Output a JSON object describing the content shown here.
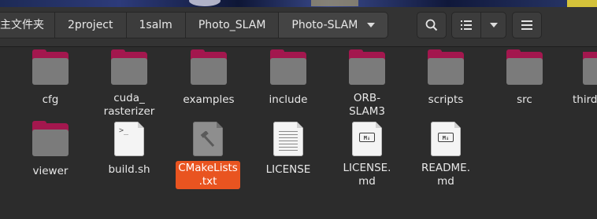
{
  "breadcrumbs": [
    {
      "label": "主文件夹"
    },
    {
      "label": "2project"
    },
    {
      "label": "1salm"
    },
    {
      "label": "Photo_SLAM"
    },
    {
      "label": "Photo-SLAM"
    }
  ],
  "toolbar": {
    "search_icon": "search-icon",
    "list_icon": "list-view-icon",
    "dropdown_icon": "chevron-down-icon",
    "menu_icon": "hamburger-menu-icon"
  },
  "files": [
    {
      "name": "cfg",
      "type": "folder"
    },
    {
      "name": "cuda_\nrasterizer",
      "type": "folder"
    },
    {
      "name": "examples",
      "type": "folder"
    },
    {
      "name": "include",
      "type": "folder"
    },
    {
      "name": "ORB-\nSLAM3",
      "type": "folder"
    },
    {
      "name": "scripts",
      "type": "folder"
    },
    {
      "name": "src",
      "type": "folder"
    },
    {
      "name": "third",
      "type": "folder"
    },
    {
      "name": "viewer",
      "type": "folder"
    },
    {
      "name": "build.sh",
      "type": "script"
    },
    {
      "name": "CMakeLists\n.txt",
      "type": "cmake",
      "selected": true
    },
    {
      "name": "LICENSE",
      "type": "text"
    },
    {
      "name": "LICENSE.\nmd",
      "type": "markdown"
    },
    {
      "name": "README.\nmd",
      "type": "markdown"
    }
  ],
  "colors": {
    "folder_back": "#a3174e",
    "folder_front": "#7b7b7b",
    "selection": "#e95420",
    "background": "#2c2c2c"
  }
}
